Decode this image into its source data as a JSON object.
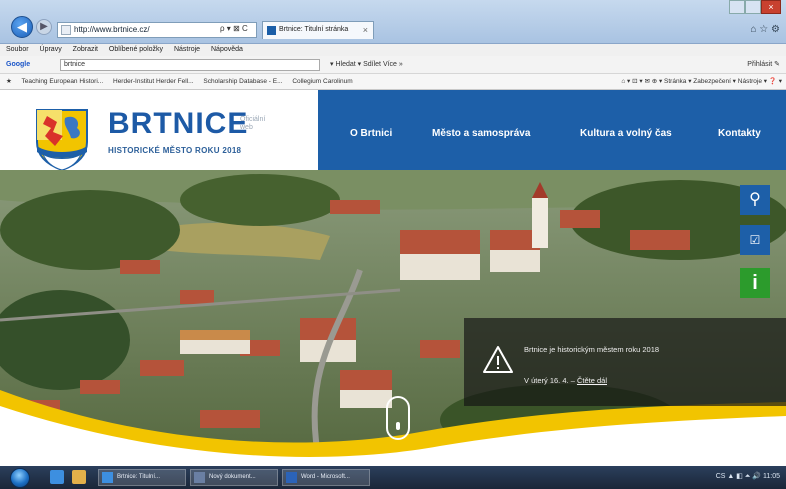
{
  "browser": {
    "address": "http://www.brtnice.cz/",
    "tab_title": "Brtnice: Titulní stránka",
    "tab_close": "×",
    "back_glyph": "◀",
    "forward_glyph": "▶",
    "addr_tools": "ρ ▾ ⊠ C",
    "right_icons": "⌂ ☆ ⚙",
    "menu": [
      "Soubor",
      "Úpravy",
      "Zobrazit",
      "Oblíbené položky",
      "Nástroje",
      "Nápověda"
    ],
    "google_label": "Google",
    "google_query": "brtnice",
    "google_buttons": "▾ Hledat ▾   Sdílet   Více »",
    "google_right": "Přihlásit ✎",
    "favorites": [
      "Teaching European Histori...",
      "Herder-Institut Herder Fell...",
      "Scholarship Database - E...",
      "Collegium Carolinum"
    ],
    "command_right": "⌂ ▾ ⊡ ▾ ✉ ⊕ ▾ Stránka ▾ Zabezpečení ▾ Nástroje ▾ ❓ ▾"
  },
  "site": {
    "brand": "BRTNICE",
    "official": "Oficiální web",
    "subtitle": "HISTORICKÉ MĚSTO ROKU 2018",
    "nav": [
      "O Brtnici",
      "Město a samospráva",
      "Kultura a volný čas",
      "Kontakty"
    ],
    "notice_text": "Brtnice je historickým městem roku 2018",
    "notice_date": "V úterý 16. 4. –",
    "notice_link": "Čtěte dál",
    "side_search_icon": "⚲",
    "side_form_icon": "☑",
    "side_info_icon": "i"
  },
  "taskbar": {
    "tasks": [
      "Brtnice: Titulní...",
      "Nový dokument...",
      "Word - Microsoft..."
    ],
    "tray": "CS  ▲ ◧ ⏶ 🔊  11:05"
  },
  "colors": {
    "brand_blue": "#1d5fa8",
    "info_green": "#2c9b2c",
    "wave_yellow": "#f2c400"
  }
}
